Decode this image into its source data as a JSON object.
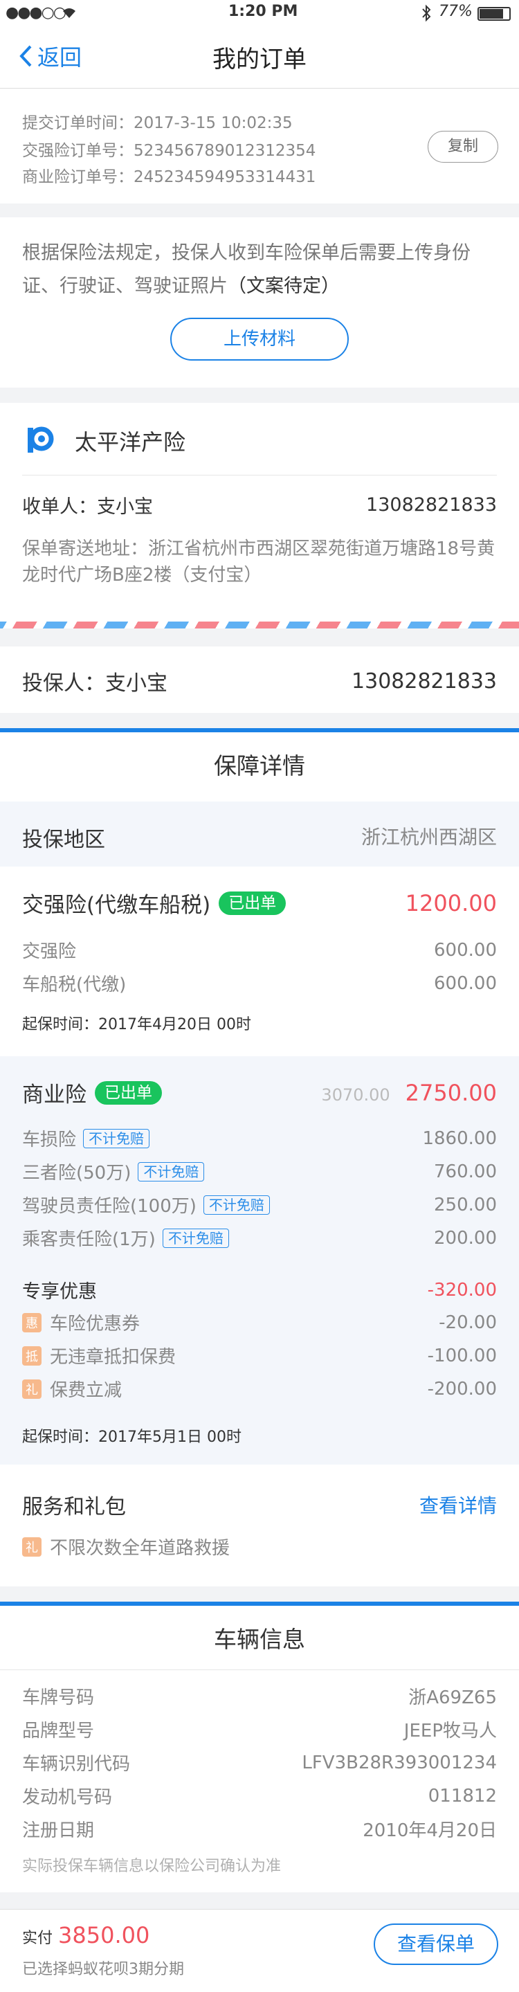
{
  "status_bar": {
    "signal": "●●●○○",
    "time": "1:20 PM",
    "battery": "77%"
  },
  "nav": {
    "back_label": "返回",
    "title": "我的订单"
  },
  "order": {
    "submit_time": "提交订单时间：2017-3-15  10:02:35",
    "jq_order_no": "交强险订单号：523456789012312354",
    "sy_order_no": "商业险订单号：245234594953314431",
    "copy_label": "复制"
  },
  "notice": {
    "text": "根据保险法规定，投保人收到车险保单后需要上传身份证、行驶证、驾驶证照片",
    "emphasis": "（文案待定）",
    "upload_label": "上传材料"
  },
  "insurer": {
    "name": "太平洋产险",
    "recipient_label": "收单人：支小宝",
    "recipient_phone": "13082821833",
    "address": "保单寄送地址：浙江省杭州市西湖区翠苑街道万塘路18号黄龙时代广场B座2楼（支付宝）"
  },
  "policyholder": {
    "label": "投保人：支小宝",
    "phone": "13082821833"
  },
  "coverage": {
    "title": "保障详情",
    "region_label": "投保地区",
    "region_value": "浙江杭州西湖区",
    "jq": {
      "title": "交强险(代缴车船税)",
      "badge": "已出单",
      "amount": "1200.00",
      "items": [
        {
          "name": "交强险",
          "value": "600.00"
        },
        {
          "name": "车船税(代缴)",
          "value": "600.00"
        }
      ],
      "start": "起保时间：2017年4月20日 00时"
    },
    "sy": {
      "title": "商业险",
      "badge": "已出单",
      "original": "3070.00",
      "amount": "2750.00",
      "items": [
        {
          "name": "车损险",
          "tag": "不计免赔",
          "value": "1860.00"
        },
        {
          "name": "三者险(50万)",
          "tag": "不计免赔",
          "value": "760.00"
        },
        {
          "name": "驾驶员责任险(100万)",
          "tag": "不计免赔",
          "value": "250.00"
        },
        {
          "name": "乘客责任险(1万)",
          "tag": "不计免赔",
          "value": "200.00"
        }
      ],
      "discount_title": "专享优惠",
      "discount_total": "-320.00",
      "discounts": [
        {
          "icon": "惠",
          "name": "车险优惠券",
          "value": "-20.00"
        },
        {
          "icon": "抵",
          "name": "无违章抵扣保费",
          "value": "-100.00"
        },
        {
          "icon": "礼",
          "name": "保费立减",
          "value": "-200.00"
        }
      ],
      "start": "起保时间：2017年5月1日 00时"
    },
    "service": {
      "title": "服务和礼包",
      "link": "查看详情",
      "icon": "礼",
      "item": "不限次数全年道路救援"
    }
  },
  "vehicle": {
    "title": "车辆信息",
    "rows": [
      {
        "label": "车牌号码",
        "value": "浙A69Z65"
      },
      {
        "label": "品牌型号",
        "value": "JEEP牧马人"
      },
      {
        "label": "车辆识别代码",
        "value": "LFV3B28R393001234"
      },
      {
        "label": "发动机号码",
        "value": "011812"
      },
      {
        "label": "注册日期",
        "value": "2010年4月20日"
      }
    ],
    "note": "实际投保车辆信息以保险公司确认为准"
  },
  "footer": {
    "paid_label": "实付",
    "paid_amount": "3850.00",
    "installment": "已选择蚂蚁花呗3期分期",
    "view_policy": "查看保单"
  },
  "colors": {
    "accent": "#1b82e6",
    "red": "#f0525d",
    "green": "#19c45d"
  }
}
